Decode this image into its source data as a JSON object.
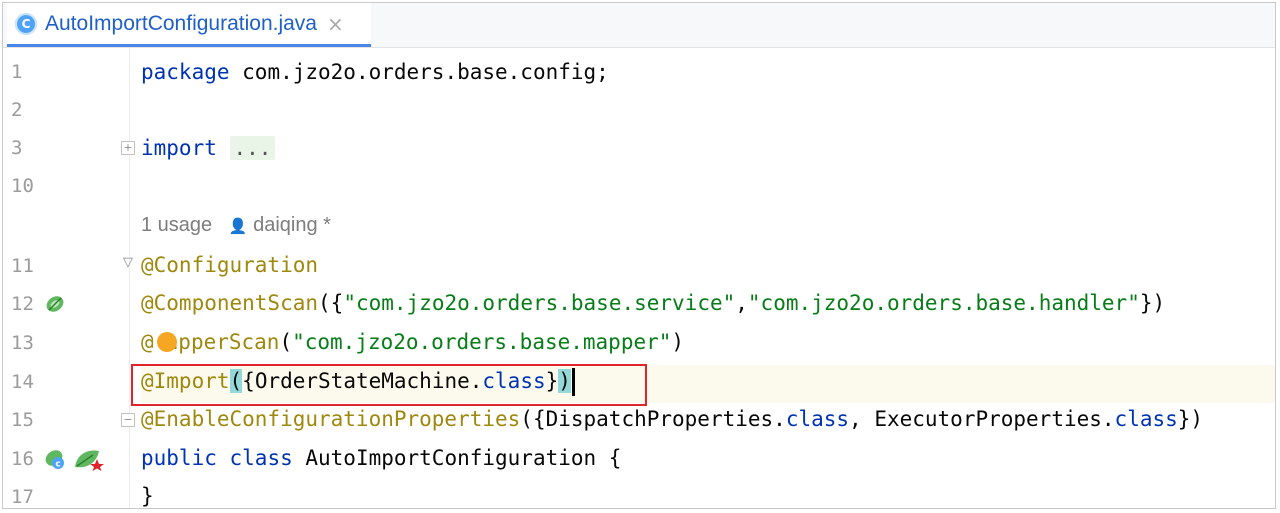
{
  "tab": {
    "icon_letter": "C",
    "label": "AutoImportConfiguration.java",
    "close": "×"
  },
  "gutter": {
    "line_numbers": [
      "1",
      "2",
      "3",
      "10",
      "11",
      "12",
      "13",
      "14",
      "15",
      "16",
      "17"
    ],
    "icons": [
      "spring-bean-icon",
      "spring-bean-icon",
      "spring-leaf-icon",
      "intention-bulb-icon"
    ]
  },
  "code": {
    "line1": {
      "kw": "package",
      "text": " com.jzo2o.orders.base.config;"
    },
    "line3": {
      "kw": "import",
      "folded": "..."
    },
    "hints": {
      "usage": "1 usage",
      "author": "daiqing *",
      "author_icon": "user-icon"
    },
    "line11": {
      "ann": "@Configuration"
    },
    "line12": {
      "ann": "@ComponentScan",
      "open": "({",
      "str1": "\"com.jzo2o.orders.base.service\"",
      "comma": ",",
      "str2": "\"com.jzo2o.orders.base.handler\"",
      "close": "})"
    },
    "line13": {
      "ann_a": "@",
      "ann_b": "apperScan",
      "open": "(",
      "str": "\"com.jzo2o.orders.base.mapper\"",
      "close": ")"
    },
    "line14": {
      "ann": "@Import",
      "open": "(",
      "text": "{OrderStateMachine.",
      "kw": "class",
      "rest": "}",
      "close": ")"
    },
    "line15": {
      "ann": "@EnableConfigurationProperties",
      "text1": "({DispatchProperties.",
      "kw1": "class",
      "text2": ", ExecutorProperties.",
      "kw2": "class",
      "text3": "})"
    },
    "line16": {
      "kw1": "public",
      "kw2": "class",
      "text": " AutoImportConfiguration {"
    },
    "line17": {
      "text": "}"
    }
  },
  "colors": {
    "keyword": "#0033b3",
    "annotation": "#9e880d",
    "string": "#067d17",
    "highlight_box": "#e0252a",
    "tab_accent": "#4a86e8"
  }
}
